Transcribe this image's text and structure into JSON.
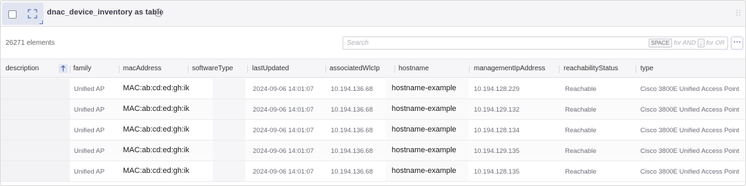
{
  "table": {
    "title": "dnac_device_inventory as table",
    "element_count": "26271 elements",
    "search_placeholder": "Search",
    "hint": {
      "and_key": "SPACE",
      "and_text": "for AND",
      "or_key": ",",
      "or_text": "for OR"
    },
    "more_label": "···",
    "columns": [
      "description",
      "family",
      "macAddress",
      "softwareType",
      "lastUpdated",
      "associatedWlcIp",
      "hostname",
      "managementIpAddress",
      "reachabilityStatus",
      "type"
    ],
    "rows": [
      {
        "description": "",
        "family": "Unified AP",
        "macAddress": "MAC:ab:cd:ed:gh:ik",
        "softwareType": "",
        "lastUpdated": "2024-09-06 14:01:07",
        "associatedWlcIp": "10.194.136.68",
        "hostname": "hostname-example",
        "managementIpAddress": "10.194.128.229",
        "reachabilityStatus": "Reachable",
        "type": "Cisco 3800E Unified Access Point"
      },
      {
        "description": "",
        "family": "Unified AP",
        "macAddress": "MAC:ab:cd:ed:gh:ik",
        "softwareType": "",
        "lastUpdated": "2024-09-06 14:01:07",
        "associatedWlcIp": "10.194.136.68",
        "hostname": "hostname-example",
        "managementIpAddress": "10.194.129.132",
        "reachabilityStatus": "Reachable",
        "type": "Cisco 3800E Unified Access Point"
      },
      {
        "description": "",
        "family": "Unified AP",
        "macAddress": "MAC:ab:cd:ed:gh:ik",
        "softwareType": "",
        "lastUpdated": "2024-09-06 14:01:07",
        "associatedWlcIp": "10.194.136.68",
        "hostname": "hostname-example",
        "managementIpAddress": "10.194.128.134",
        "reachabilityStatus": "Reachable",
        "type": "Cisco 3800E Unified Access Point"
      },
      {
        "description": "",
        "family": "Unified AP",
        "macAddress": "MAC:ab:cd:ed:gh:ik",
        "softwareType": "",
        "lastUpdated": "2024-09-06 14:01:07",
        "associatedWlcIp": "10.194.136.68",
        "hostname": "hostname-example",
        "managementIpAddress": "10.194.129.135",
        "reachabilityStatus": "Reachable",
        "type": "Cisco 3800E Unified Access Point"
      },
      {
        "description": "",
        "family": "Unified AP",
        "macAddress": "MAC:ab:cd:ed:gh:ik",
        "softwareType": "",
        "lastUpdated": "2024-09-06 14:01:07",
        "associatedWlcIp": "10.194.136.68",
        "hostname": "hostname-example",
        "managementIpAddress": "10.194.128.135",
        "reachabilityStatus": "Reachable",
        "type": "Cisco 3800E Unified Access Point"
      }
    ]
  },
  "colors": {
    "accent": "#4a5c9e",
    "header_bg": "#f6f6f8",
    "selection_bg": "#e1e5f1"
  },
  "icons": {
    "select": "checkbox-icon",
    "expand": "expand-icon",
    "info": "info-icon",
    "sort": "sort-ascending-icon",
    "drag": "grip-icon",
    "menu": "more-icon"
  }
}
